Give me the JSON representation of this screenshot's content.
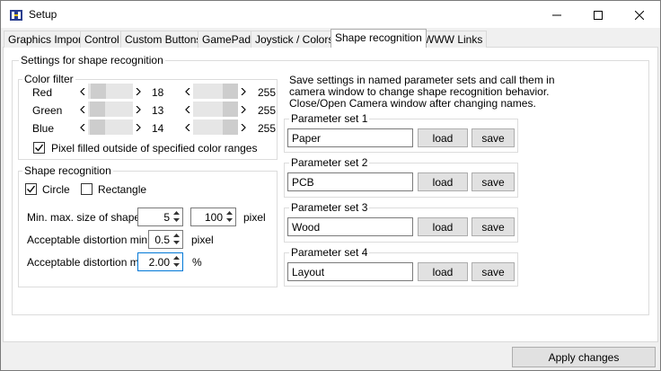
{
  "window": {
    "title": "Setup",
    "minimize_glyph": "–",
    "maximize_glyph": "☐",
    "close_glyph": "✕"
  },
  "tabs": [
    {
      "label": "Graphics Import",
      "active": false
    },
    {
      "label": "Control",
      "active": false
    },
    {
      "label": "Custom Buttons",
      "active": false
    },
    {
      "label": "GamePad",
      "active": false
    },
    {
      "label": "Joystick / Colors",
      "active": false
    },
    {
      "label": "Shape recognition",
      "active": true
    },
    {
      "label": "WWW Links",
      "active": false
    }
  ],
  "settings": {
    "label": "Settings for shape recognition",
    "color_filter": {
      "label": "Color filter",
      "rows": [
        {
          "name": "Red",
          "min_value": "18",
          "max_value": "255"
        },
        {
          "name": "Green",
          "min_value": "13",
          "max_value": "255"
        },
        {
          "name": "Blue",
          "min_value": "14",
          "max_value": "255"
        }
      ],
      "pixel_filled_label": "Pixel filled outside of specified color ranges",
      "pixel_filled_checked": true
    },
    "shape": {
      "label": "Shape recognition",
      "circle_label": "Circle",
      "circle_checked": true,
      "rectangle_label": "Rectangle",
      "rectangle_checked": false,
      "min_max_label": "Min. max. size of shape",
      "min_size": "5",
      "max_size": "100",
      "size_unit": "pixel",
      "dist_min_label": "Acceptable distortion min.",
      "dist_min": "0.5",
      "dist_min_unit": "pixel",
      "dist_max_label": "Acceptable distortion max.",
      "dist_max": "2.00",
      "dist_max_unit": "%"
    }
  },
  "info_text": {
    "line1": "Save settings in named parameter sets and call them in",
    "line2": "camera window to change shape recognition behavior.",
    "line3": "Close/Open Camera window after changing names."
  },
  "param_sets": [
    {
      "label": "Parameter set 1",
      "value": "Paper",
      "load": "load",
      "save": "save"
    },
    {
      "label": "Parameter set 2",
      "value": "PCB",
      "load": "load",
      "save": "save"
    },
    {
      "label": "Parameter set 3",
      "value": "Wood",
      "load": "load",
      "save": "save"
    },
    {
      "label": "Parameter set 4",
      "value": "Layout",
      "load": "load",
      "save": "save"
    }
  ],
  "apply_label": "Apply changes",
  "colors": {
    "check_mark": "#000000",
    "accent_border": "#adadad",
    "slider_thumb": "#cdcdcd",
    "slider_track": "#e6e6e6"
  }
}
